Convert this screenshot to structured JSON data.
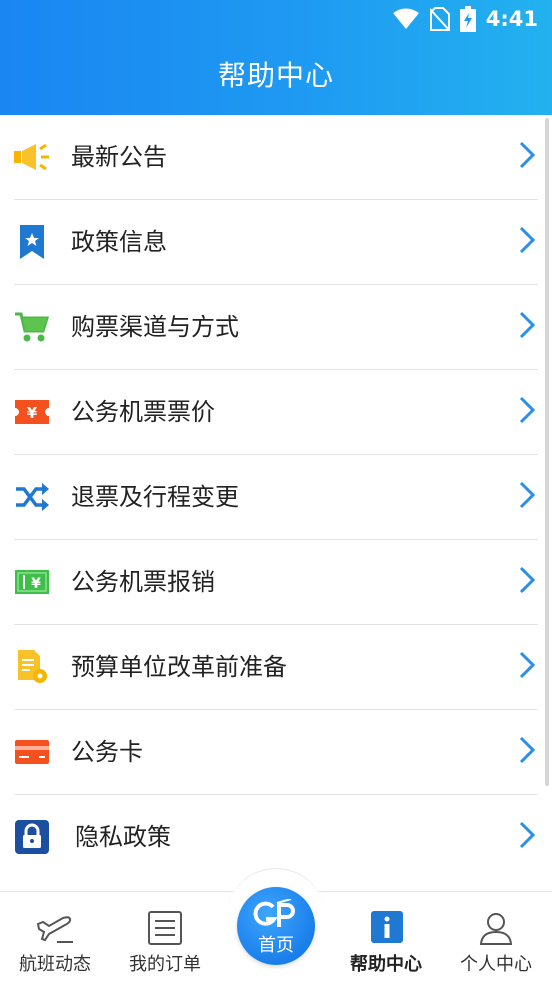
{
  "status": {
    "time": "4:41"
  },
  "header": {
    "title": "帮助中心"
  },
  "items": [
    {
      "label": "最新公告",
      "icon": "megaphone-icon"
    },
    {
      "label": "政策信息",
      "icon": "bookmark-star-icon"
    },
    {
      "label": "购票渠道与方式",
      "icon": "shopping-cart-icon"
    },
    {
      "label": "公务机票票价",
      "icon": "yuan-ticket-icon"
    },
    {
      "label": "退票及行程变更",
      "icon": "shuffle-icon"
    },
    {
      "label": "公务机票报销",
      "icon": "yuan-banknote-icon"
    },
    {
      "label": "预算单位改革前准备",
      "icon": "document-gear-icon"
    },
    {
      "label": "公务卡",
      "icon": "credit-card-icon"
    },
    {
      "label": "隐私政策",
      "icon": "lock-icon"
    }
  ],
  "tabs": [
    {
      "label": "航班动态",
      "icon": "flight-icon"
    },
    {
      "label": "我的订单",
      "icon": "order-list-icon"
    },
    {
      "label": "首页",
      "icon": "gp-logo-icon"
    },
    {
      "label": "帮助中心",
      "icon": "info-icon"
    },
    {
      "label": "个人中心",
      "icon": "person-icon"
    }
  ],
  "colors": {
    "accent": "#1a86f2",
    "chevron": "#2a8fe8"
  }
}
